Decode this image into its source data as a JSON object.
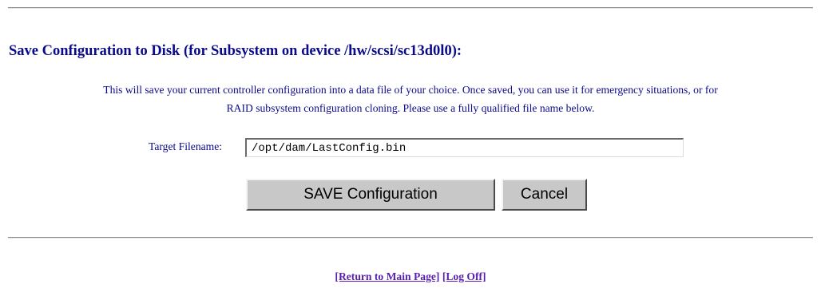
{
  "page": {
    "title": "Save Configuration to Disk (for Subsystem on device /hw/scsi/sc13d0l0):",
    "description_lines": [
      "This will save your current controller configuration into a data file of your choice. Once saved, you can use it for emergency situations, or for",
      "RAID subsystem configuration cloning. Please use a fully qualified file name below."
    ]
  },
  "form": {
    "target_label": "Target Filename:",
    "target_value": "/opt/dam/LastConfig.bin",
    "save_label": "SAVE Configuration",
    "cancel_label": "Cancel"
  },
  "footer": {
    "return_link": "[Return to Main Page]",
    "logoff_link": "[Log Off]"
  },
  "colors": {
    "text": "#0a0a8a",
    "visited_link": "#5a1fb0",
    "button_face": "#c8c8c8"
  }
}
